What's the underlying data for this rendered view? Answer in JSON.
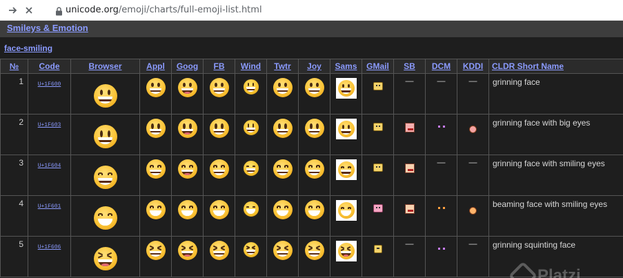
{
  "browser": {
    "url_domain": "unicode.org",
    "url_path": "/emoji/charts/full-emoji-list.html"
  },
  "page": {
    "section_title": "Smileys & Emotion",
    "subsection_title": "face-smiling",
    "columns": [
      "№",
      "Code",
      "Browser",
      "Appl",
      "Goog",
      "FB",
      "Wind",
      "Twtr",
      "Joy",
      "Sams",
      "GMail",
      "SB",
      "DCM",
      "KDDI",
      "CLDR Short Name"
    ],
    "dash": "—",
    "rows": [
      {
        "num": "1",
        "code": "U+1F600",
        "name": "grinning face"
      },
      {
        "num": "2",
        "code": "U+1F603",
        "name": "grinning face with big eyes"
      },
      {
        "num": "3",
        "code": "U+1F604",
        "name": "grinning face with smiling eyes"
      },
      {
        "num": "4",
        "code": "U+1F601",
        "name": "beaming face with smiling eyes"
      },
      {
        "num": "5",
        "code": "U+1F606",
        "name": "grinning squinting face"
      }
    ],
    "watermark": "Platzi"
  },
  "colors": {
    "link": "#8b9bff",
    "section_bg": "#3d3d3d",
    "page_bg": "#1e1e1e"
  }
}
